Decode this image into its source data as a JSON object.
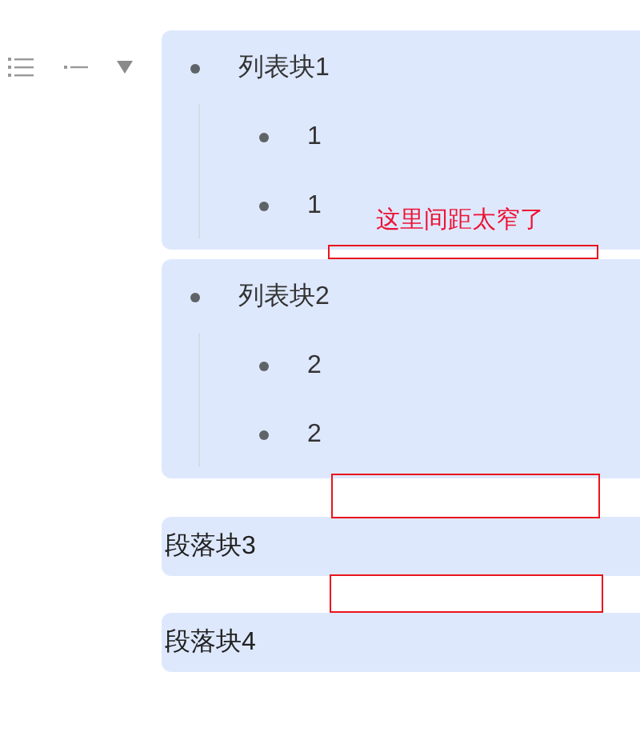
{
  "blocks": [
    {
      "kind": "list",
      "text": "列表块1",
      "children": [
        {
          "text": "1"
        },
        {
          "text": "1"
        }
      ]
    },
    {
      "kind": "list",
      "text": "列表块2",
      "children": [
        {
          "text": "2"
        },
        {
          "text": "2"
        }
      ]
    },
    {
      "kind": "paragraph",
      "text": "段落块3"
    },
    {
      "kind": "paragraph",
      "text": "段落块4"
    }
  ],
  "annotations": [
    {
      "kind": "box",
      "note": "这里间距太窄了"
    },
    {
      "kind": "box"
    },
    {
      "kind": "box"
    }
  ]
}
